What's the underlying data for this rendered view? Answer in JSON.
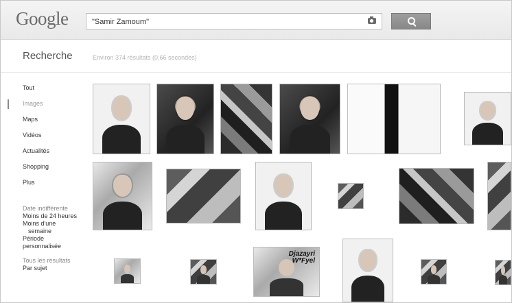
{
  "header": {
    "logo": "Google",
    "search_value": "\"Samir Zamoum\"",
    "camera_icon": "camera-icon",
    "search_icon": "magnifier-icon"
  },
  "results": {
    "section_title": "Recherche",
    "stats": "Environ 374 résultats (0,66 secondes)"
  },
  "sidebar": {
    "items": [
      {
        "label": "Tout"
      },
      {
        "label": "Images"
      },
      {
        "label": "Maps"
      },
      {
        "label": "Vidéos"
      },
      {
        "label": "Actualités"
      },
      {
        "label": "Shopping"
      },
      {
        "label": "Plus"
      }
    ],
    "tools": [
      {
        "label": "Date indifférente"
      },
      {
        "label": "Moins de 24 heures"
      },
      {
        "label": "Moins d'une"
      },
      {
        "label": "semaine"
      },
      {
        "label": "Période"
      },
      {
        "label": "personnalisée"
      },
      {
        "label": "Tous les résultats"
      },
      {
        "label": "Par sujet"
      }
    ]
  },
  "thumbnails": {
    "baby_text_line1": "Djazayri",
    "baby_text_line2": "W*Fyel"
  }
}
